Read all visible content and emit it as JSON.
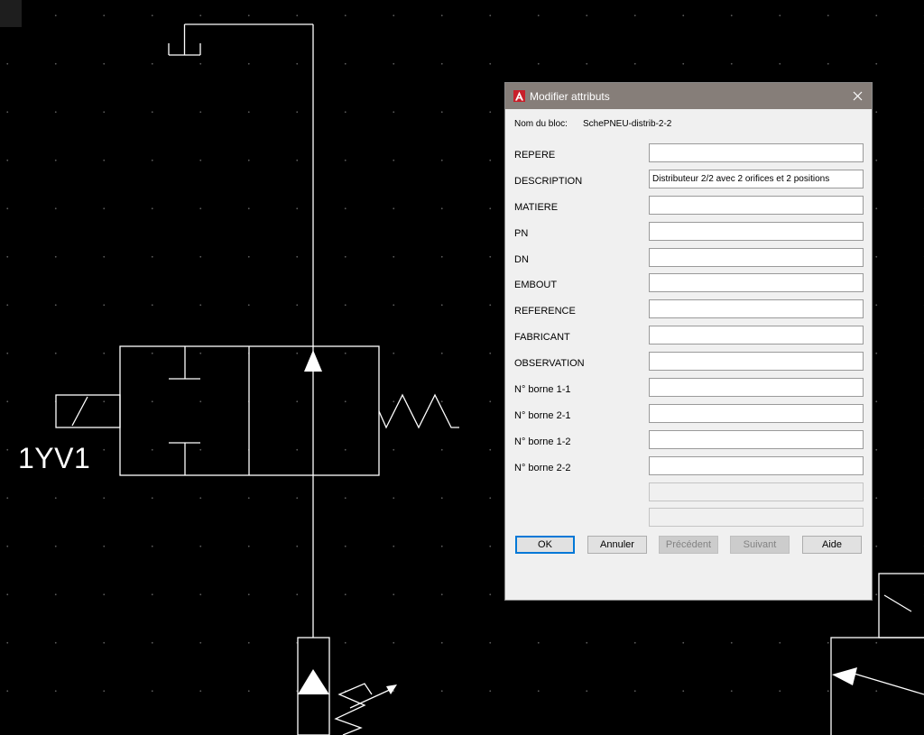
{
  "drawing": {
    "component_tag": "1YV1"
  },
  "dialog": {
    "title": "Modifier attributs",
    "block_name_label": "Nom du bloc:",
    "block_name_value": "SchePNEU-distrib-2-2",
    "fields": [
      {
        "label": "REPERE",
        "value": ""
      },
      {
        "label": "DESCRIPTION",
        "value": "Distributeur 2/2 avec 2 orifices et 2 positions"
      },
      {
        "label": "MATIERE",
        "value": ""
      },
      {
        "label": "PN",
        "value": ""
      },
      {
        "label": "DN",
        "value": ""
      },
      {
        "label": "EMBOUT",
        "value": ""
      },
      {
        "label": "REFERENCE",
        "value": ""
      },
      {
        "label": "FABRICANT",
        "value": ""
      },
      {
        "label": "OBSERVATION",
        "value": ""
      },
      {
        "label": "N° borne 1-1",
        "value": ""
      },
      {
        "label": "N° borne 2-1",
        "value": ""
      },
      {
        "label": "N° borne 1-2",
        "value": ""
      },
      {
        "label": "N° borne 2-2",
        "value": ""
      },
      {
        "label": "",
        "value": "",
        "disabled": true
      },
      {
        "label": "",
        "value": "",
        "disabled": true
      }
    ],
    "buttons": {
      "ok": "OK",
      "cancel": "Annuler",
      "previous": "Précédent",
      "next": "Suivant",
      "help": "Aide"
    }
  },
  "colors": {
    "background": "#000000",
    "lines": "#ffffff",
    "titlebar": "#867e79",
    "dialog_bg": "#f0f0f0",
    "focus_border": "#0078d7",
    "app_icon": "#c8202a"
  }
}
